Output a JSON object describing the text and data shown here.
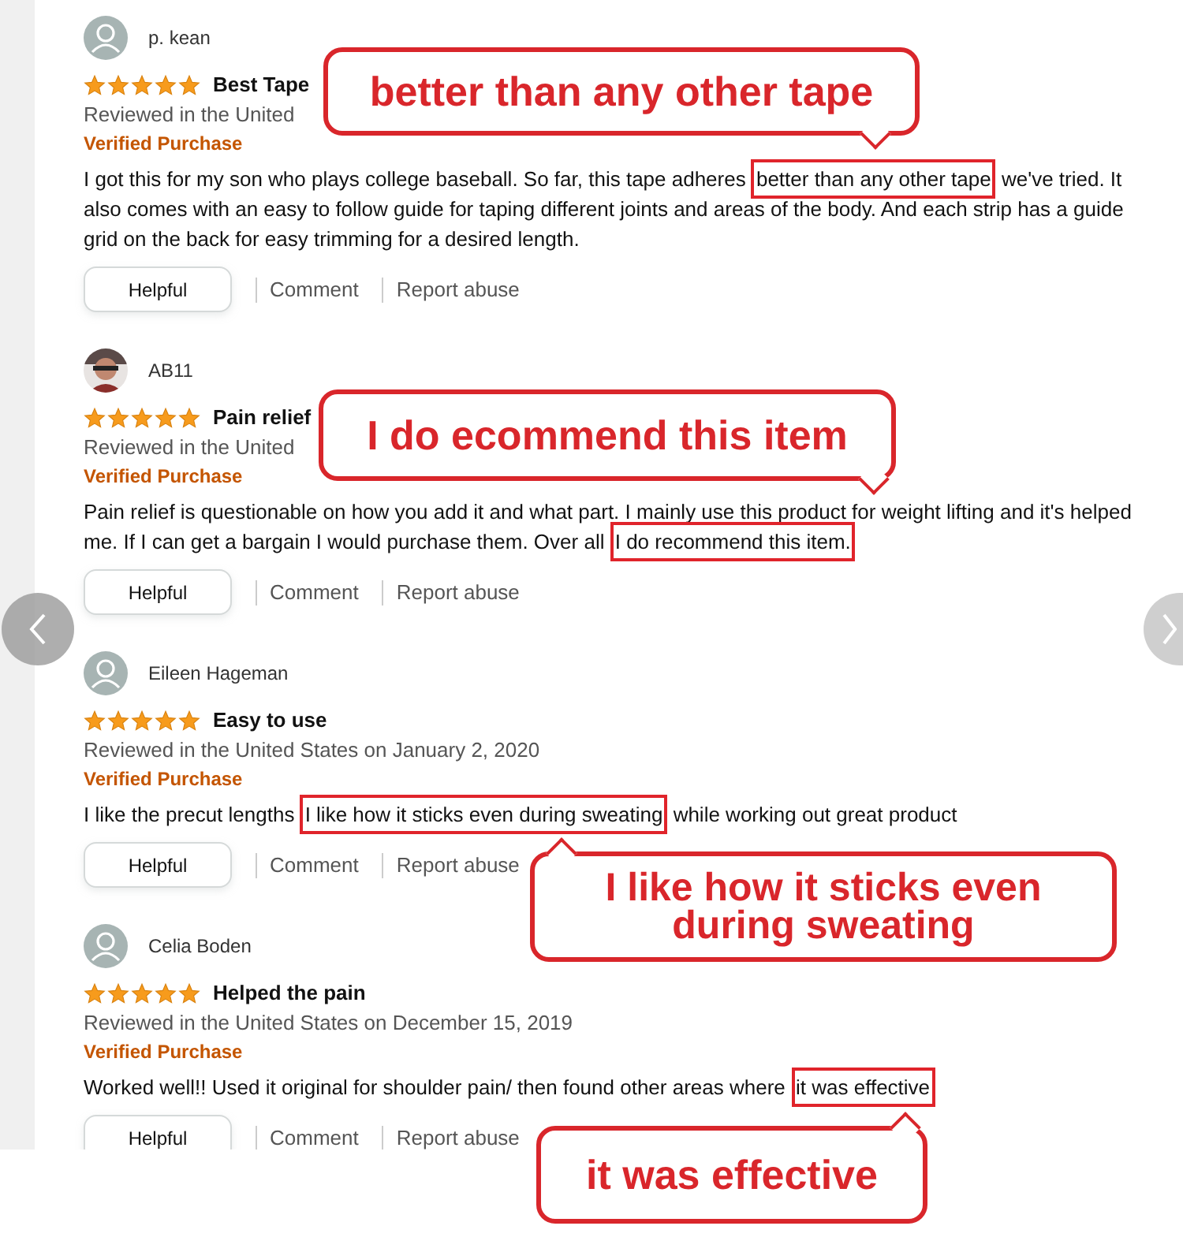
{
  "reviews": [
    {
      "name": "p. kean",
      "avatar": {
        "kind": "default"
      },
      "stars": 5,
      "title": "Best Tape",
      "date": "Reviewed in the United",
      "badge": "Verified Purchase",
      "body": [
        {
          "text": "I got this for my son who plays college baseball. So far, this tape adheres ",
          "highlighted": false
        },
        {
          "text": "better than any other tape",
          "highlighted": true
        },
        {
          "text": " we've tried. It also comes with an easy to follow guide for taping different joints and areas of the body. And each strip has a guide grid on the back for easy trimming for a desired length.",
          "highlighted": false
        }
      ],
      "actions": [
        "Helpful",
        "Comment",
        "Report abuse"
      ]
    },
    {
      "name": "AB11",
      "avatar": {
        "kind": "picture"
      },
      "stars": 5,
      "title": "Pain relief",
      "date": "Reviewed in the United",
      "badge": "Verified Purchase",
      "body": [
        {
          "text": "Pain relief is questionable on how you add it and what part. I mainly use this product for weight lifting and it's helped me. If I can get a bargain I would purchase them. Over all ",
          "highlighted": false
        },
        {
          "text": "I do recommend this item.",
          "highlighted": true
        }
      ],
      "actions": [
        "Helpful",
        "Comment",
        "Report abuse"
      ]
    },
    {
      "name": "Eileen Hageman",
      "avatar": {
        "kind": "default"
      },
      "stars": 5,
      "title": "Easy to use",
      "date": "Reviewed in the United States on January 2, 2020",
      "badge": "Verified Purchase",
      "body": [
        {
          "text": "I like the precut lengths ",
          "highlighted": false
        },
        {
          "text": "I like how it sticks even during sweating",
          "highlighted": true
        },
        {
          "text": " while working out great product",
          "highlighted": false
        }
      ],
      "actions": [
        "Helpful",
        "Comment",
        "Report abuse"
      ]
    },
    {
      "name": "Celia Boden",
      "avatar": {
        "kind": "default"
      },
      "stars": 5,
      "title": "Helped the pain",
      "date": "Reviewed in the United States on December 15, 2019",
      "badge": "Verified Purchase",
      "body": [
        {
          "text": "Worked well!! Used it original for shoulder pain/ then found other areas where ",
          "highlighted": false
        },
        {
          "text": "it was effective",
          "highlighted": true
        }
      ],
      "actions": [
        "Helpful",
        "Comment",
        "Report abuse"
      ]
    }
  ],
  "callouts": [
    {
      "text": "better than any other tape"
    },
    {
      "text": "I do ecommend this item"
    },
    {
      "text": "I like how it sticks even during sweating"
    },
    {
      "text": "it was effective"
    }
  ]
}
